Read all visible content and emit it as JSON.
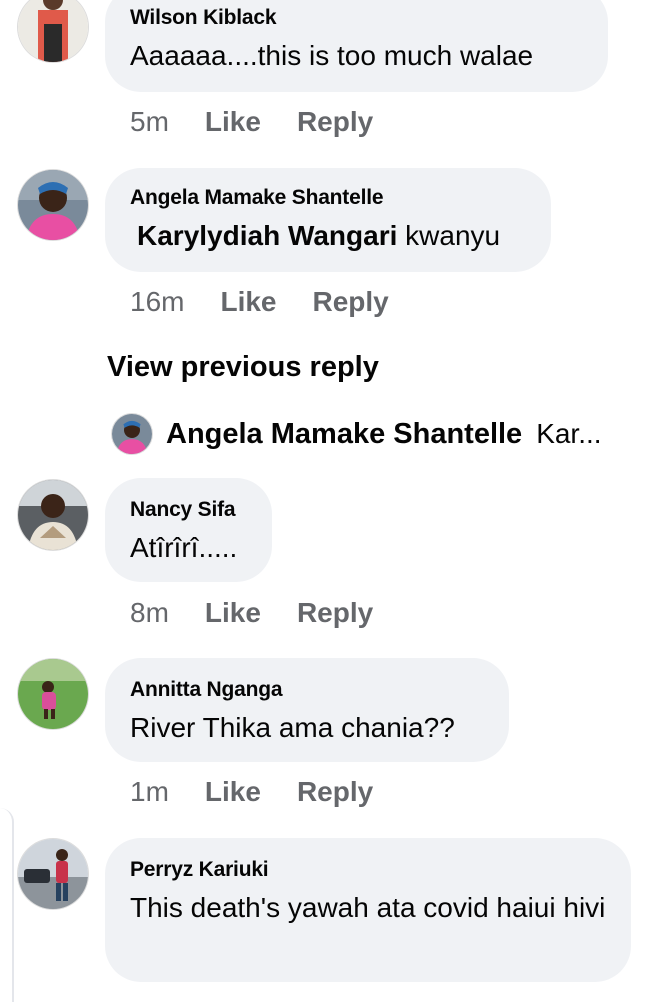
{
  "comments": [
    {
      "author": "Wilson Kiblack",
      "text": "Aaaaaa....this is too much walae",
      "time": "5m",
      "like": "Like",
      "reply": "Reply"
    },
    {
      "author": "Angela Mamake Shantelle",
      "mention": "Karylydiah Wangari",
      "text": " kwanyu",
      "time": "16m",
      "like": "Like",
      "reply": "Reply"
    },
    {
      "author": "Nancy Sifa",
      "text": "Atîrîrî.....",
      "time": "8m",
      "like": "Like",
      "reply": "Reply"
    },
    {
      "author": "Annitta Nganga",
      "text": "River Thika ama chania??",
      "time": "1m",
      "like": "Like",
      "reply": "Reply"
    },
    {
      "author": "Perryz Kariuki",
      "text": "This death's yawah ata covid haiui hivi"
    }
  ],
  "view_previous": "View previous reply",
  "reply_preview": {
    "author": "Angela Mamake Shantelle",
    "text": "Kar..."
  }
}
